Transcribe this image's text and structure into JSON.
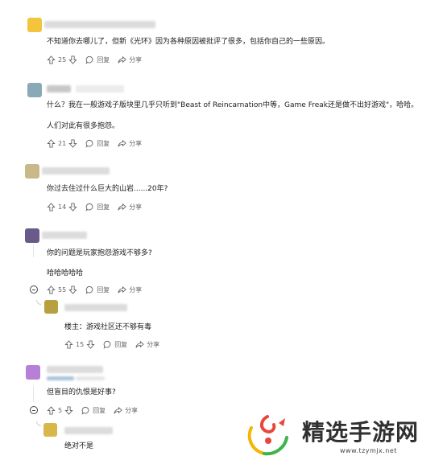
{
  "comments": [
    {
      "text": "不知道你去哪儿了，但新《光环》因为各种原因被批评了很多，包括你自己的一些原因。",
      "votes": "25",
      "reply_label": "回复",
      "share_label": "分享"
    },
    {
      "text_line1": "什么？我在一般游戏子版块里几乎只听到\"Beast of Reincarnation中等，Game Freak还是做不出好游戏\"，哈哈。",
      "text_line2": "人们对此有很多抱怨。",
      "votes": "21",
      "reply_label": "回复",
      "share_label": "分享"
    },
    {
      "text": "你过去住过什么巨大的山岩......20年?",
      "votes": "14",
      "reply_label": "回复",
      "share_label": "分享"
    },
    {
      "text_line1": "你的问题是玩家抱怨游戏不够多?",
      "text_line2": "哈哈哈哈哈",
      "votes": "55",
      "reply_label": "回复",
      "share_label": "分享"
    },
    {
      "text": "楼主：游戏社区还不够有毒",
      "votes": "15",
      "reply_label": "回复",
      "share_label": "分享"
    },
    {
      "text": "但盲目的仇恨是好事?",
      "votes": "5",
      "reply_label": "回复",
      "share_label": "分享"
    },
    {
      "text": "绝对不是"
    }
  ],
  "watermark": {
    "name": "精选手游网",
    "url": "www.tzymjx.net"
  },
  "colors": {
    "avatar1": "#f2c53d",
    "avatar2": "#8aa9b8",
    "avatar3": "#c9b98a",
    "avatar4": "#6a5a8a",
    "avatar5": "#b8a040",
    "avatar6": "#b77fd6",
    "avatar7": "#d9b64a",
    "logo_red": "#e8463a",
    "logo_yellow": "#f2b705",
    "logo_green": "#3fb44a"
  }
}
